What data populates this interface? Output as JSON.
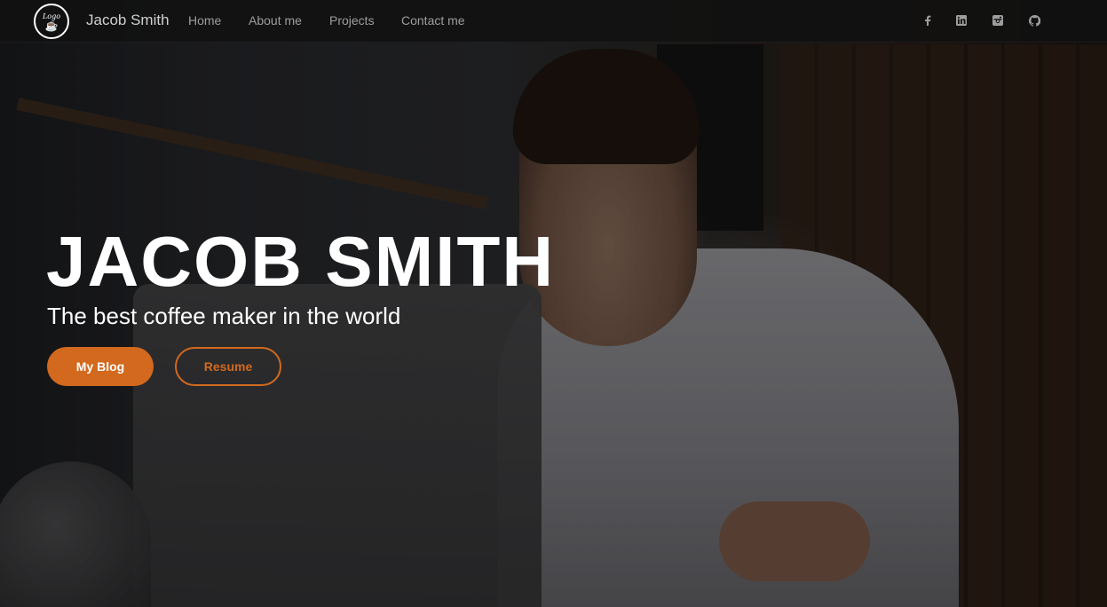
{
  "navbar": {
    "logo_text": "Logo",
    "brand": "Jacob Smith",
    "links": [
      {
        "label": "Home"
      },
      {
        "label": "About me"
      },
      {
        "label": "Projects"
      },
      {
        "label": "Contact me"
      }
    ],
    "social_icons": [
      "facebook-icon",
      "linkedin-icon",
      "instagram-icon",
      "github-icon"
    ]
  },
  "hero": {
    "title": "JACOB SMITH",
    "subtitle": "The best coffee maker in the world",
    "primary_button": "My Blog",
    "secondary_button": "Resume"
  },
  "colors": {
    "accent": "#d2691e",
    "navbar_bg": "#111111",
    "nav_text": "#9d9d9d"
  }
}
